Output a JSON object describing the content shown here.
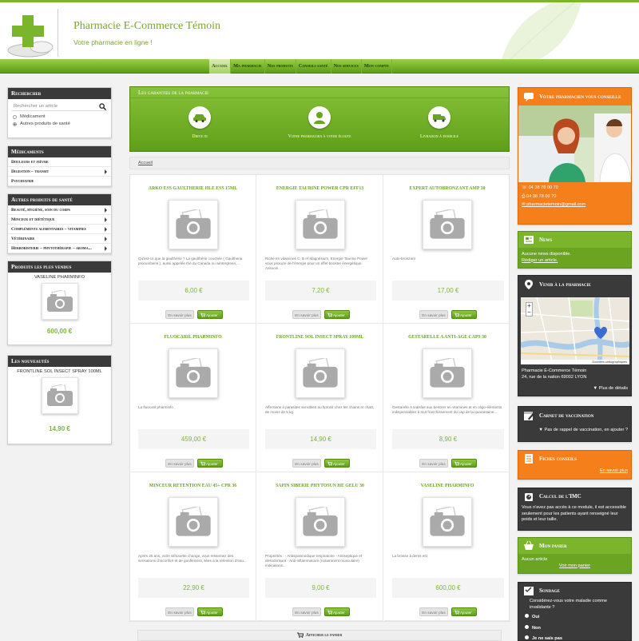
{
  "header": {
    "title": "Pharmacie E-Commerce Témoin",
    "tagline": "Votre pharmacie en ligne !"
  },
  "nav": [
    {
      "label": "Accueil",
      "active": true
    },
    {
      "label": "Ma pharmacie"
    },
    {
      "label": "Nos produits"
    },
    {
      "label": "Conseils santé"
    },
    {
      "label": "Nos services"
    },
    {
      "label": "Mon compte"
    }
  ],
  "search": {
    "title": "Rechercher",
    "placeholder": "Rechercher un article",
    "opt1": "Médicament",
    "opt2": "Autres produits de santé"
  },
  "medicaments": {
    "title": "Médicaments",
    "items": [
      "Douleurs et fièvre",
      "Digestion – transit",
      "Psychiatrie"
    ]
  },
  "autres": {
    "title": "Autres produits de santé",
    "items": [
      "Beauté, hygiène, soin du corps",
      "Minceur et diététique",
      "Compléments alimentaires – vitamines",
      "Vétérinaire",
      "Herboristerie – phytothérapie – aroma..."
    ]
  },
  "best": {
    "title": "Produits les plus vendus",
    "name": "VASELINE PHARMINFO",
    "price": "600,00 €"
  },
  "news_box": {
    "title": "Les nouveautés",
    "name": "FRONTLINE SOL INSECT SPRAY 100ML",
    "price": "14,90 €"
  },
  "guarantees": {
    "title": "Les garanties de la pharmacie",
    "items": [
      "Drive in",
      "Votre pharmacien à votre écoute",
      "Livraison à domicile"
    ]
  },
  "breadcrumb": "Accueil",
  "buttons": {
    "more": "En savoir plus",
    "add": "Ajouter"
  },
  "products": [
    {
      "name": "ARKO ESS GAULTHERIE HLE ESS 15ML",
      "desc": "Qu'est-ce que la gaulthérie ? La gaulthérie couchée ( Gaultheria procumbens ), aussi appelée thé du Canada ou wintergreen,...",
      "price": "6,00 €"
    },
    {
      "name": "ENERGIE TAURINE POWER CPR EFF13",
      "desc": "Riche en vitamines C, B et Magnésium, Energie Taurine Power vous procure de l'énergie pour un effet booster énergétique. Associé...",
      "price": "7,20 €"
    },
    {
      "name": "EXPERT AUTOBRONZANT AMP 30",
      "desc": "Auto-bronzant",
      "price": "17,00 €"
    },
    {
      "name": "FLUOCARIL PHARMINFO",
      "desc": "La fluocaril pharminfo",
      "price": "459,00 €"
    },
    {
      "name": "FRONTLINE SOL INSECT SPRAY 100ML",
      "desc": "Affections à parasites sensibles au fipronil chez les chiens et chats de moins de 5 kg.",
      "price": "14,90 €"
    },
    {
      "name": "GESTARELLE A ANTI-AGE CAPS 30",
      "desc": "Gestarelle A satisfait aux besoins en vitamines et en oligo-éléments indispensables à tout franchissement du cap de la quarantaine...",
      "price": "8,90 €"
    },
    {
      "name": "MINCEUR RETENTION EAU 45+ CPR 36",
      "desc": "Après 45 ans, votre silhouette change, vous ressentez des sensations d'inconfort et de gonflement, liées à la rétention d'eau...",
      "price": "22,90 €"
    },
    {
      "name": "SAPIN SIBERIE PHYTOSUN HE GELU 30",
      "desc": "Propriétés : - Antispasmodique respiratoire - Antiseptique et désodorisant - Anti-inflammatoire (notamment musculaire) Indications...",
      "price": "9,00 €"
    },
    {
      "name": "VASELINE PHARMINFO",
      "desc": "La brosse à dents est",
      "price": "600,00 €"
    }
  ],
  "cart_link": "Afficher le panier",
  "advice": {
    "title": "Votre pharmacien vous conseille",
    "phone1": "04 38 78 00 70",
    "phone2": "04 38 78 00 70",
    "email": "pharmacietemoin@gmail.com"
  },
  "news": {
    "title": "News",
    "text": "Aucune news disponible.",
    "link": "Rédiger un article."
  },
  "visit": {
    "title": "Venir à la pharmacie",
    "name": "Pharmacie E-Commerce Témoin",
    "address": "24, rue de la nation 69002 LYON",
    "more": "Plus de détails",
    "map_footer": "Données cartographiques"
  },
  "vacc": {
    "title": "Carnet de vaccination",
    "text": "Pas de rappel de vaccination, en ajouter ?"
  },
  "fiches": {
    "title": "Fiches conseils",
    "more": "En savoir plus"
  },
  "imc": {
    "title": "Calcul de l'IMC",
    "text": "Vous n'avez pas accès à ce module, il est accessible seulement pour les patients ayant renseigné leur poids et leur taille."
  },
  "panier": {
    "title": "Mon panier",
    "text": "Aucun article",
    "link": "Voir mon panier"
  },
  "sondage": {
    "title": "Sondage",
    "question": "Considérez-vous votre maladie comme invalidante ?",
    "options": [
      "Oui",
      "Non",
      "Je ne sais pas"
    ]
  },
  "colors": {
    "green": "#6aa421",
    "orange": "#f57f1b",
    "dark": "#3a3a3a"
  }
}
